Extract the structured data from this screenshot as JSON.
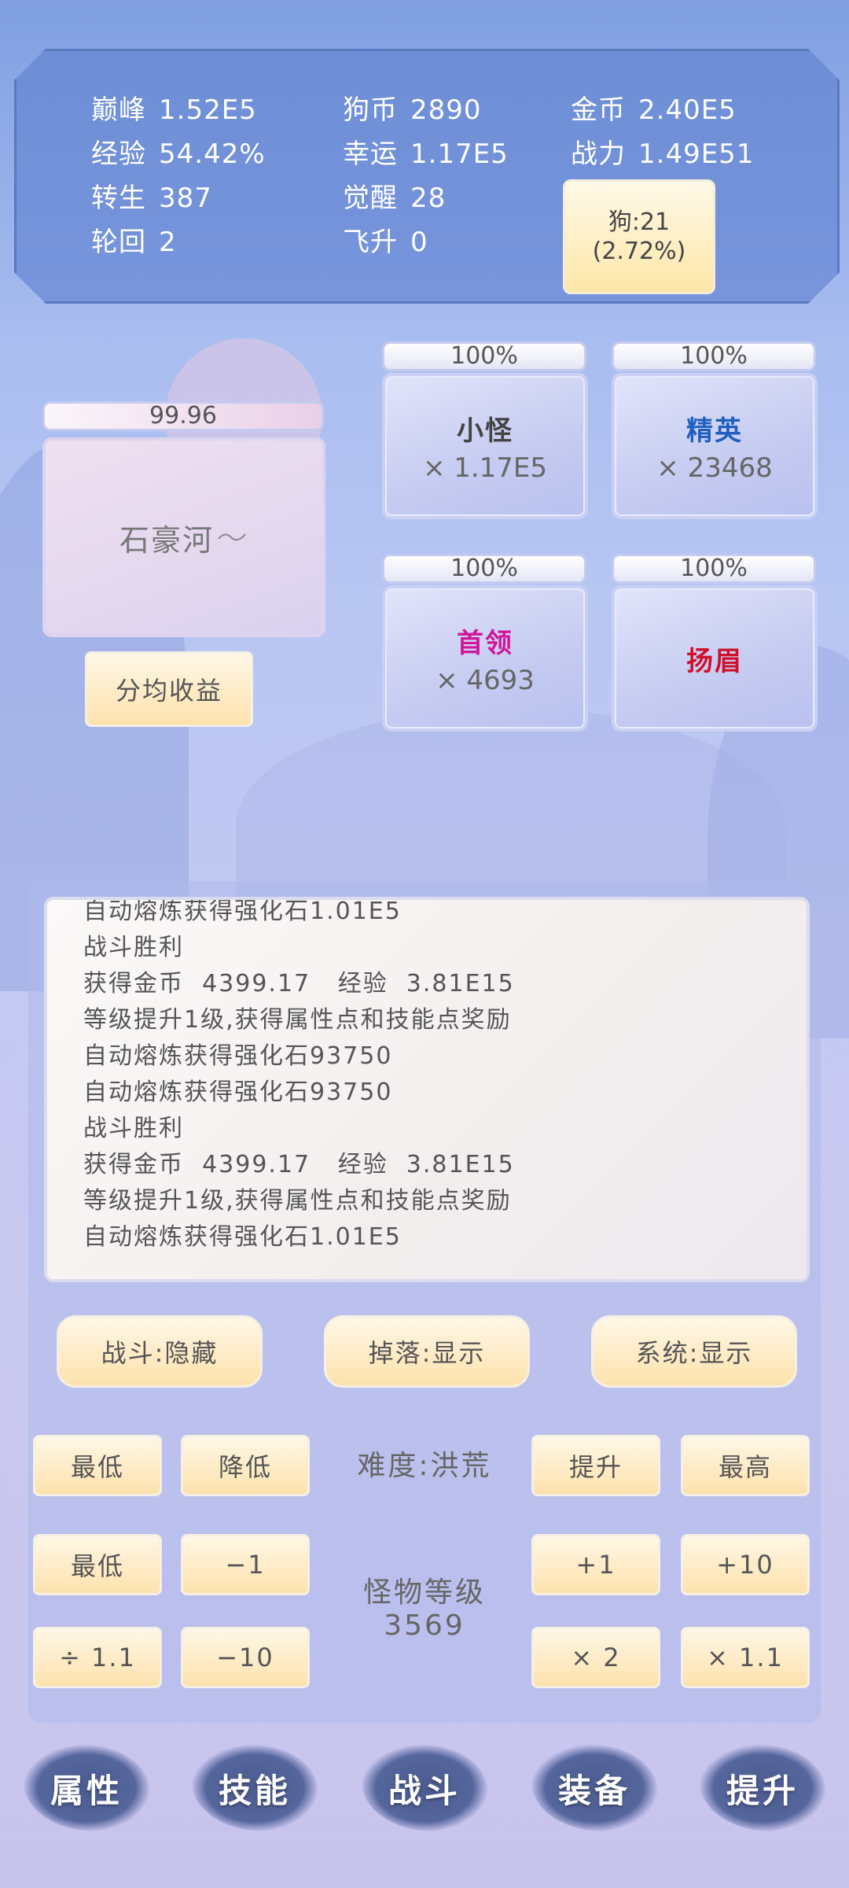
{
  "stats": [
    {
      "key": "巅峰",
      "value": "1.52E5"
    },
    {
      "key": "狗币",
      "value": "2890"
    },
    {
      "key": "金币",
      "value": "2.40E5"
    },
    {
      "key": "经验",
      "value": "54.42%"
    },
    {
      "key": "幸运",
      "value": "1.17E5"
    },
    {
      "key": "战力",
      "value": "1.49E51"
    },
    {
      "key": "转生",
      "value": "387"
    },
    {
      "key": "觉醒",
      "value": "28"
    },
    {
      "key": "轮回",
      "value": "2"
    },
    {
      "key": "飞升",
      "value": "0"
    }
  ],
  "dog": {
    "line1": "狗:21",
    "line2": "(2.72%)"
  },
  "player": {
    "hp": "99.96",
    "name": "石豪河"
  },
  "split_button": "分均收益",
  "enemies": [
    {
      "progress": "100%",
      "name": "小怪",
      "count": "× 1.17E5",
      "color": "#444444"
    },
    {
      "progress": "100%",
      "name": "精英",
      "count": "× 23468",
      "color": "#1f5fc0"
    },
    {
      "progress": "100%",
      "name": "首领",
      "count": "× 4693",
      "color": "#d0169a"
    },
    {
      "progress": "100%",
      "name": "扬眉",
      "count": "",
      "color": "#d0102a"
    }
  ],
  "log": [
    "自动熔炼获得强化石1.01E5",
    "战斗胜利",
    "获得金币  4399.17   经验  3.81E15",
    "等级提升1级,获得属性点和技能点奖励",
    "自动熔炼获得强化石93750",
    "自动熔炼获得强化石93750",
    "战斗胜利",
    "获得金币  4399.17   经验  3.81E15",
    "等级提升1级,获得属性点和技能点奖励",
    "自动熔炼获得强化石1.01E5"
  ],
  "filters": {
    "battle": "战斗:隐藏",
    "drop": "掉落:显示",
    "system": "系统:显示"
  },
  "difficulty": {
    "label": "难度:洪荒",
    "min": "最低",
    "down": "降低",
    "up": "提升",
    "max": "最高"
  },
  "monster_level": {
    "label": "怪物等级",
    "value": "3569",
    "min": "最低",
    "minus1": "−1",
    "div11": "÷ 1.1",
    "minus10": "−10",
    "plus1": "+1",
    "plus10": "+10",
    "times2": "× 2",
    "times11": "× 1.1"
  },
  "nav": [
    "属性",
    "技能",
    "战斗",
    "装备",
    "提升"
  ]
}
